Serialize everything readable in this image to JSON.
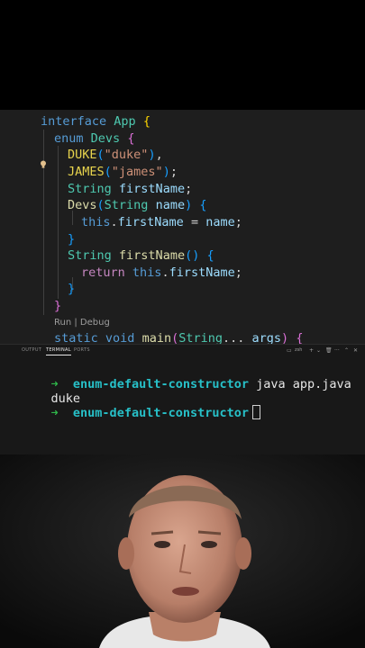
{
  "editor": {
    "lines": [
      {
        "id": "l1",
        "parts": [
          [
            "kw",
            "interface"
          ],
          [
            "",
            " "
          ],
          [
            "ty",
            "App"
          ],
          [
            "",
            " "
          ],
          [
            "br1",
            "{"
          ]
        ]
      },
      {
        "id": "l2",
        "parts": [
          [
            "kw",
            "enum"
          ],
          [
            "",
            " "
          ],
          [
            "ty",
            "Devs"
          ],
          [
            "",
            " "
          ],
          [
            "br2",
            "{"
          ]
        ]
      },
      {
        "id": "l3",
        "parts": [
          [
            "cst",
            "DUKE"
          ],
          [
            "br3",
            "("
          ],
          [
            "str",
            "\"duke\""
          ],
          [
            "br3",
            ")"
          ],
          [
            "",
            ","
          ]
        ]
      },
      {
        "id": "l4",
        "parts": [
          [
            "cst",
            "JAMES"
          ],
          [
            "br3",
            "("
          ],
          [
            "str",
            "\"james\""
          ],
          [
            "br3",
            ")"
          ],
          [
            "",
            ";"
          ]
        ]
      },
      {
        "id": "l5",
        "parts": [
          [
            "ty",
            "String"
          ],
          [
            "",
            " "
          ],
          [
            "var",
            "firstName"
          ],
          [
            "",
            ";"
          ]
        ]
      },
      {
        "id": "l6",
        "parts": [
          [
            "fn",
            "Devs"
          ],
          [
            "br3",
            "("
          ],
          [
            "ty",
            "String"
          ],
          [
            "",
            " "
          ],
          [
            "var",
            "name"
          ],
          [
            "br3",
            ")"
          ],
          [
            "",
            " "
          ],
          [
            "br3",
            "{"
          ]
        ]
      },
      {
        "id": "l7",
        "parts": [
          [
            "kw",
            "this"
          ],
          [
            "",
            "."
          ],
          [
            "var",
            "firstName"
          ],
          [
            "",
            " = "
          ],
          [
            "var",
            "name"
          ],
          [
            "",
            ";"
          ]
        ]
      },
      {
        "id": "l8",
        "parts": [
          [
            "br3",
            "}"
          ]
        ]
      },
      {
        "id": "l9",
        "parts": [
          [
            "ty",
            "String"
          ],
          [
            "",
            " "
          ],
          [
            "fn",
            "firstName"
          ],
          [
            "br3",
            "()"
          ],
          [
            "",
            " "
          ],
          [
            "br3",
            "{"
          ]
        ]
      },
      {
        "id": "l10",
        "parts": [
          [
            "ctrl",
            "return"
          ],
          [
            "",
            " "
          ],
          [
            "kw",
            "this"
          ],
          [
            "",
            "."
          ],
          [
            "var",
            "firstName"
          ],
          [
            "",
            ";"
          ]
        ]
      },
      {
        "id": "l11",
        "parts": [
          [
            "br3",
            "}"
          ]
        ]
      },
      {
        "id": "l12",
        "parts": [
          [
            "br2",
            "}"
          ]
        ]
      },
      {
        "id": "l13",
        "parts": [
          [
            "kw",
            "static"
          ],
          [
            "",
            " "
          ],
          [
            "kw",
            "void"
          ],
          [
            "",
            " "
          ],
          [
            "fn",
            "main"
          ],
          [
            "br2",
            "("
          ],
          [
            "ty",
            "String"
          ],
          [
            "",
            "... "
          ],
          [
            "var",
            "args"
          ],
          [
            "br2",
            ")"
          ],
          [
            "",
            " "
          ],
          [
            "br2",
            "{"
          ]
        ]
      }
    ],
    "codelens": "Run | Debug"
  },
  "panel": {
    "tabs": [
      "OUTPUT",
      "TERMINAL",
      "PORTS"
    ],
    "active_tab": "TERMINAL",
    "shell_label": "zsh",
    "terminal": {
      "prompt_arrow": "➜",
      "dir": "enum-default-constructor",
      "command": "java app.java",
      "output": "duke"
    }
  }
}
